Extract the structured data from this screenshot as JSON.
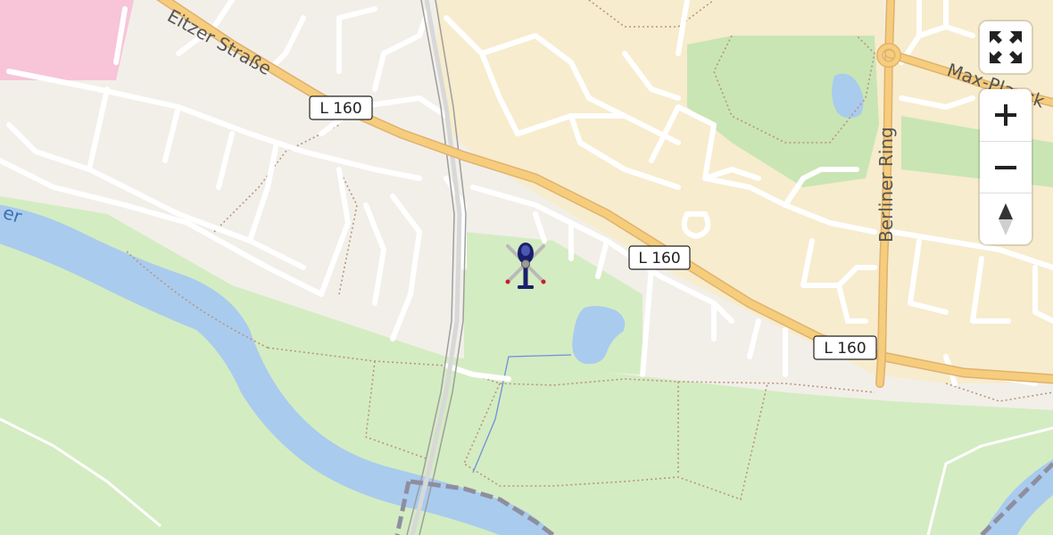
{
  "map": {
    "labels": {
      "eitzer_strasse": "Eitzer Straße",
      "berliner_ring": "Berliner Ring",
      "max_planck": "Max-Planck",
      "river_fragment": "er"
    },
    "road_shields": [
      "L 160",
      "L 160",
      "L 160"
    ],
    "colors": {
      "background": "#f2efe9",
      "meadow": "#d4ecc2",
      "park": "#c9e5b4",
      "industrial": "#f7eccd",
      "residential_pink": "#f8c4d8",
      "river": "#a9cbee",
      "main_road": "#f6cd7d",
      "street": "#ffffff",
      "rail": "#a6a6a6",
      "marker_navy": "#1b1f6b"
    }
  },
  "marker": {
    "icon": "helicopter-icon"
  },
  "controls": {
    "fullscreen_icon": "fullscreen-icon",
    "zoom_in_icon": "zoom-in-icon",
    "zoom_out_icon": "zoom-out-icon",
    "north_icon": "compass-north-icon"
  }
}
